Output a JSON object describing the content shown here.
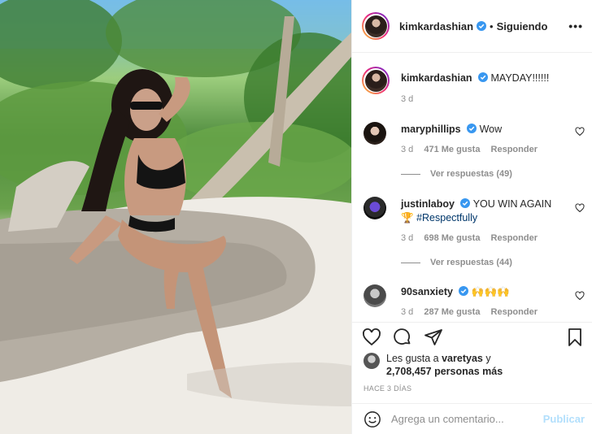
{
  "post": {
    "author": "kimkardashian",
    "follow_status": "Siguiendo",
    "more_icon": "•••"
  },
  "caption": {
    "user": "kimkardashian",
    "text": "MAYDAY!!!!!!",
    "time": "3 d"
  },
  "comments": [
    {
      "user": "maryphillips",
      "text": "Wow",
      "time": "3 d",
      "likes": "471 Me gusta",
      "reply_label": "Responder",
      "view_replies": "Ver respuestas (49)"
    },
    {
      "user": "justinlaboy",
      "text": "YOU WIN AGAIN",
      "emoji": "🏆",
      "hashtag": "#Respectfully",
      "time": "3 d",
      "likes": "698 Me gusta",
      "reply_label": "Responder",
      "view_replies": "Ver respuestas (44)"
    },
    {
      "user": "90sanxiety",
      "text": "🙌🙌🙌",
      "time": "3 d",
      "likes": "287 Me gusta",
      "reply_label": "Responder"
    }
  ],
  "likes_summary": {
    "line1_prefix": "Les gusta a ",
    "liker": "varetyas",
    "line1_suffix": " y",
    "line2": "2,708,457 personas más"
  },
  "time_ago": "HACE 3 DÍAS",
  "composer": {
    "placeholder": "Agrega un comentario...",
    "publish_label": "Publicar"
  },
  "colors": {
    "verified": "#3897f0",
    "link": "#00376b",
    "publish_disabled": "#b2dffc",
    "muted": "#8e8e8e"
  }
}
